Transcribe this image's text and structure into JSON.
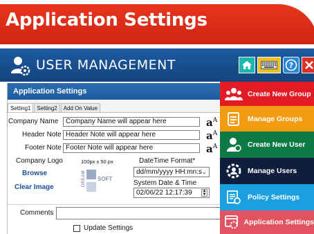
{
  "banner": {
    "title": "Application Settings"
  },
  "app": {
    "title": "USER MANAGEMENT"
  },
  "panel": {
    "title": "Application Settings",
    "tabs": [
      "Setting1",
      "Setting2",
      "Add On Value"
    ],
    "company_name": {
      "label": "Company Name",
      "value": "Company Name will appear here"
    },
    "header_note": {
      "label": "Header Note",
      "value": "Header Note will appear here"
    },
    "footer_note": {
      "label": "Footer Note",
      "value": "Footer Note will appear here"
    },
    "company_logo": {
      "label": "Company Logo",
      "size_hint": "100px x 50 px",
      "browse": "Browse",
      "clear": "Clear Image",
      "logo_text_left": "DREAM",
      "logo_text_right": "SOFT"
    },
    "datetime_format": {
      "label": "DateTime Format*",
      "value": "dd/mm/yyyy HH:mn:s"
    },
    "system_datetime": {
      "label": "System Date & Time",
      "value": "02/06/22 12:17:39"
    },
    "comments": {
      "label": "Comments",
      "value": ""
    },
    "update": {
      "label": "Update Settings",
      "checked": false
    }
  },
  "menu": [
    {
      "label": "Create New Group",
      "color": "#e21b25",
      "icon": "group-add-icon"
    },
    {
      "label": "Manage Groups",
      "color": "#f39c12",
      "icon": "document-list-icon"
    },
    {
      "label": "Create New User",
      "color": "#0d7a45",
      "icon": "user-add-icon"
    },
    {
      "label": "Manage Users",
      "color": "#0f1e3d",
      "icon": "user-gear-icon"
    },
    {
      "label": "Policy Settings",
      "color": "#1aa0de",
      "icon": "policy-icon"
    },
    {
      "label": "Application Settings",
      "color": "#e15360",
      "icon": "settings-window-icon"
    }
  ],
  "colors": {
    "banner": "#e8341c",
    "header": "#1d5aa0",
    "panel_head": "#2b6db2"
  }
}
